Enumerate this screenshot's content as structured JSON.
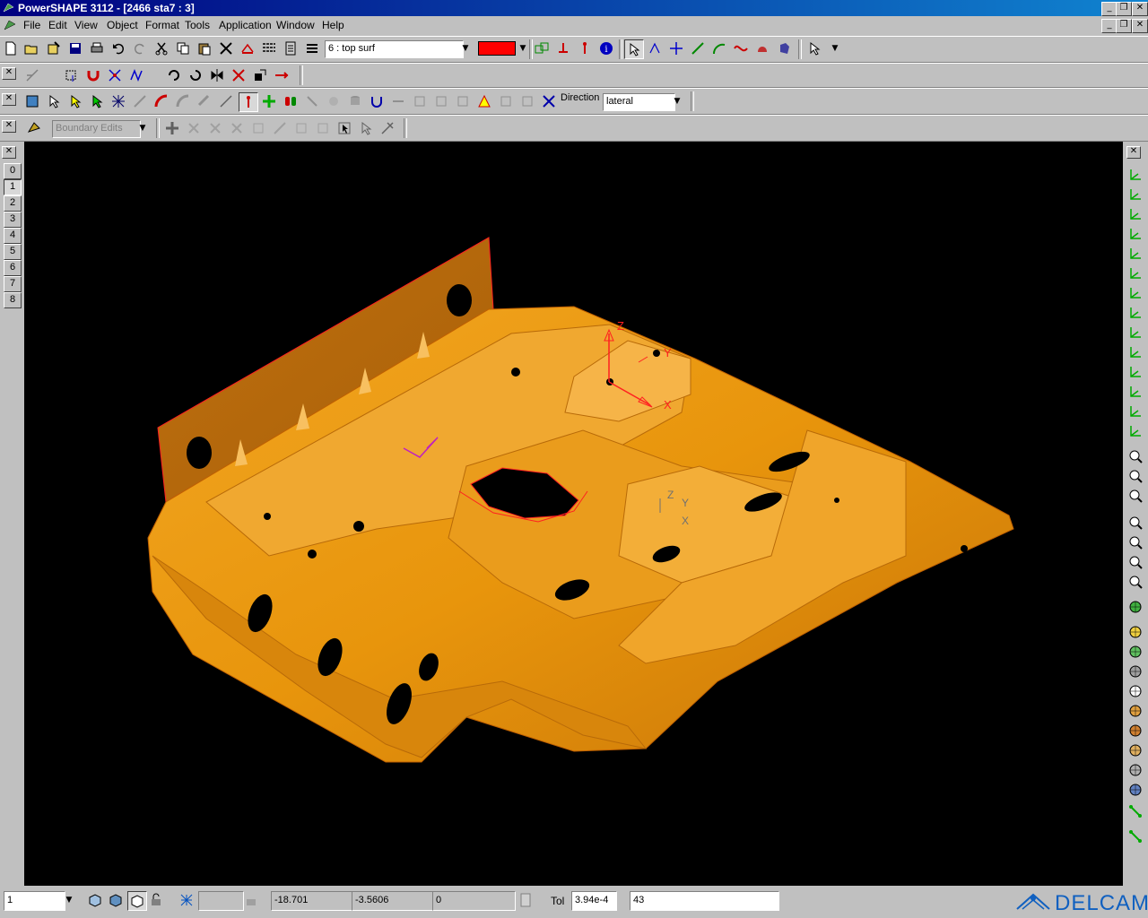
{
  "window": {
    "title": "PowerSHAPE 3112 - [2466 sta7 : 3]"
  },
  "menu": {
    "items": [
      "File",
      "Edit",
      "View",
      "Object",
      "Format",
      "Tools",
      "Application",
      "Window",
      "Help"
    ]
  },
  "toolbar": {
    "level_select": "6   : top surf",
    "color_swatch": "#ff0000",
    "direction_label": "Direction",
    "direction_value": "lateral",
    "boundary_edits": "Boundary Edits"
  },
  "levels": [
    "0",
    "1",
    "2",
    "3",
    "4",
    "5",
    "6",
    "7",
    "8"
  ],
  "status": {
    "selection_count": "1",
    "x": "-18.701",
    "y": "-3.5606",
    "z": "0",
    "tol_label": "Tol",
    "tol_value": "3.94e-4",
    "message": "43",
    "brand": "DELCAM"
  },
  "viewport": {
    "background": "#000000",
    "model_color": "#e8950c",
    "axis_labels": {
      "z": "Z",
      "y": "Y",
      "x": "X"
    },
    "secondary_axis_labels": {
      "z": "Z",
      "y": "Y",
      "x": "X"
    }
  }
}
